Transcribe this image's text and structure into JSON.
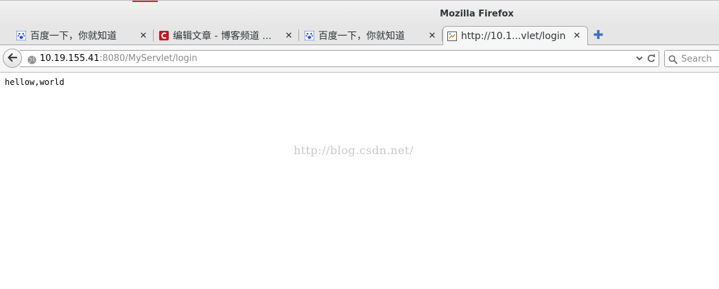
{
  "window": {
    "title": "Mozilla Firefox"
  },
  "tabs": [
    {
      "title": "百度一下，你就知道",
      "favicon": "baidu-paw-icon",
      "active": false
    },
    {
      "title": "编辑文章 - 博客频道 ...",
      "favicon": "csdn-c-icon",
      "active": false
    },
    {
      "title": "百度一下，你就知道",
      "favicon": "baidu-paw-icon",
      "active": false
    },
    {
      "title": "http://10.1...vlet/login",
      "favicon": "page-icon",
      "active": true
    }
  ],
  "toolbar": {
    "url_host": "10.19.155.41",
    "url_rest": ":8080/MyServlet/login",
    "search_placeholder": "Search"
  },
  "page": {
    "body_text": "hellow,world",
    "watermark": "http://blog.csdn.net/"
  },
  "colors": {
    "accent_blue": "#3b6fc4",
    "csdn_red": "#c9151e",
    "baidu_blue": "#2c4fd6"
  }
}
